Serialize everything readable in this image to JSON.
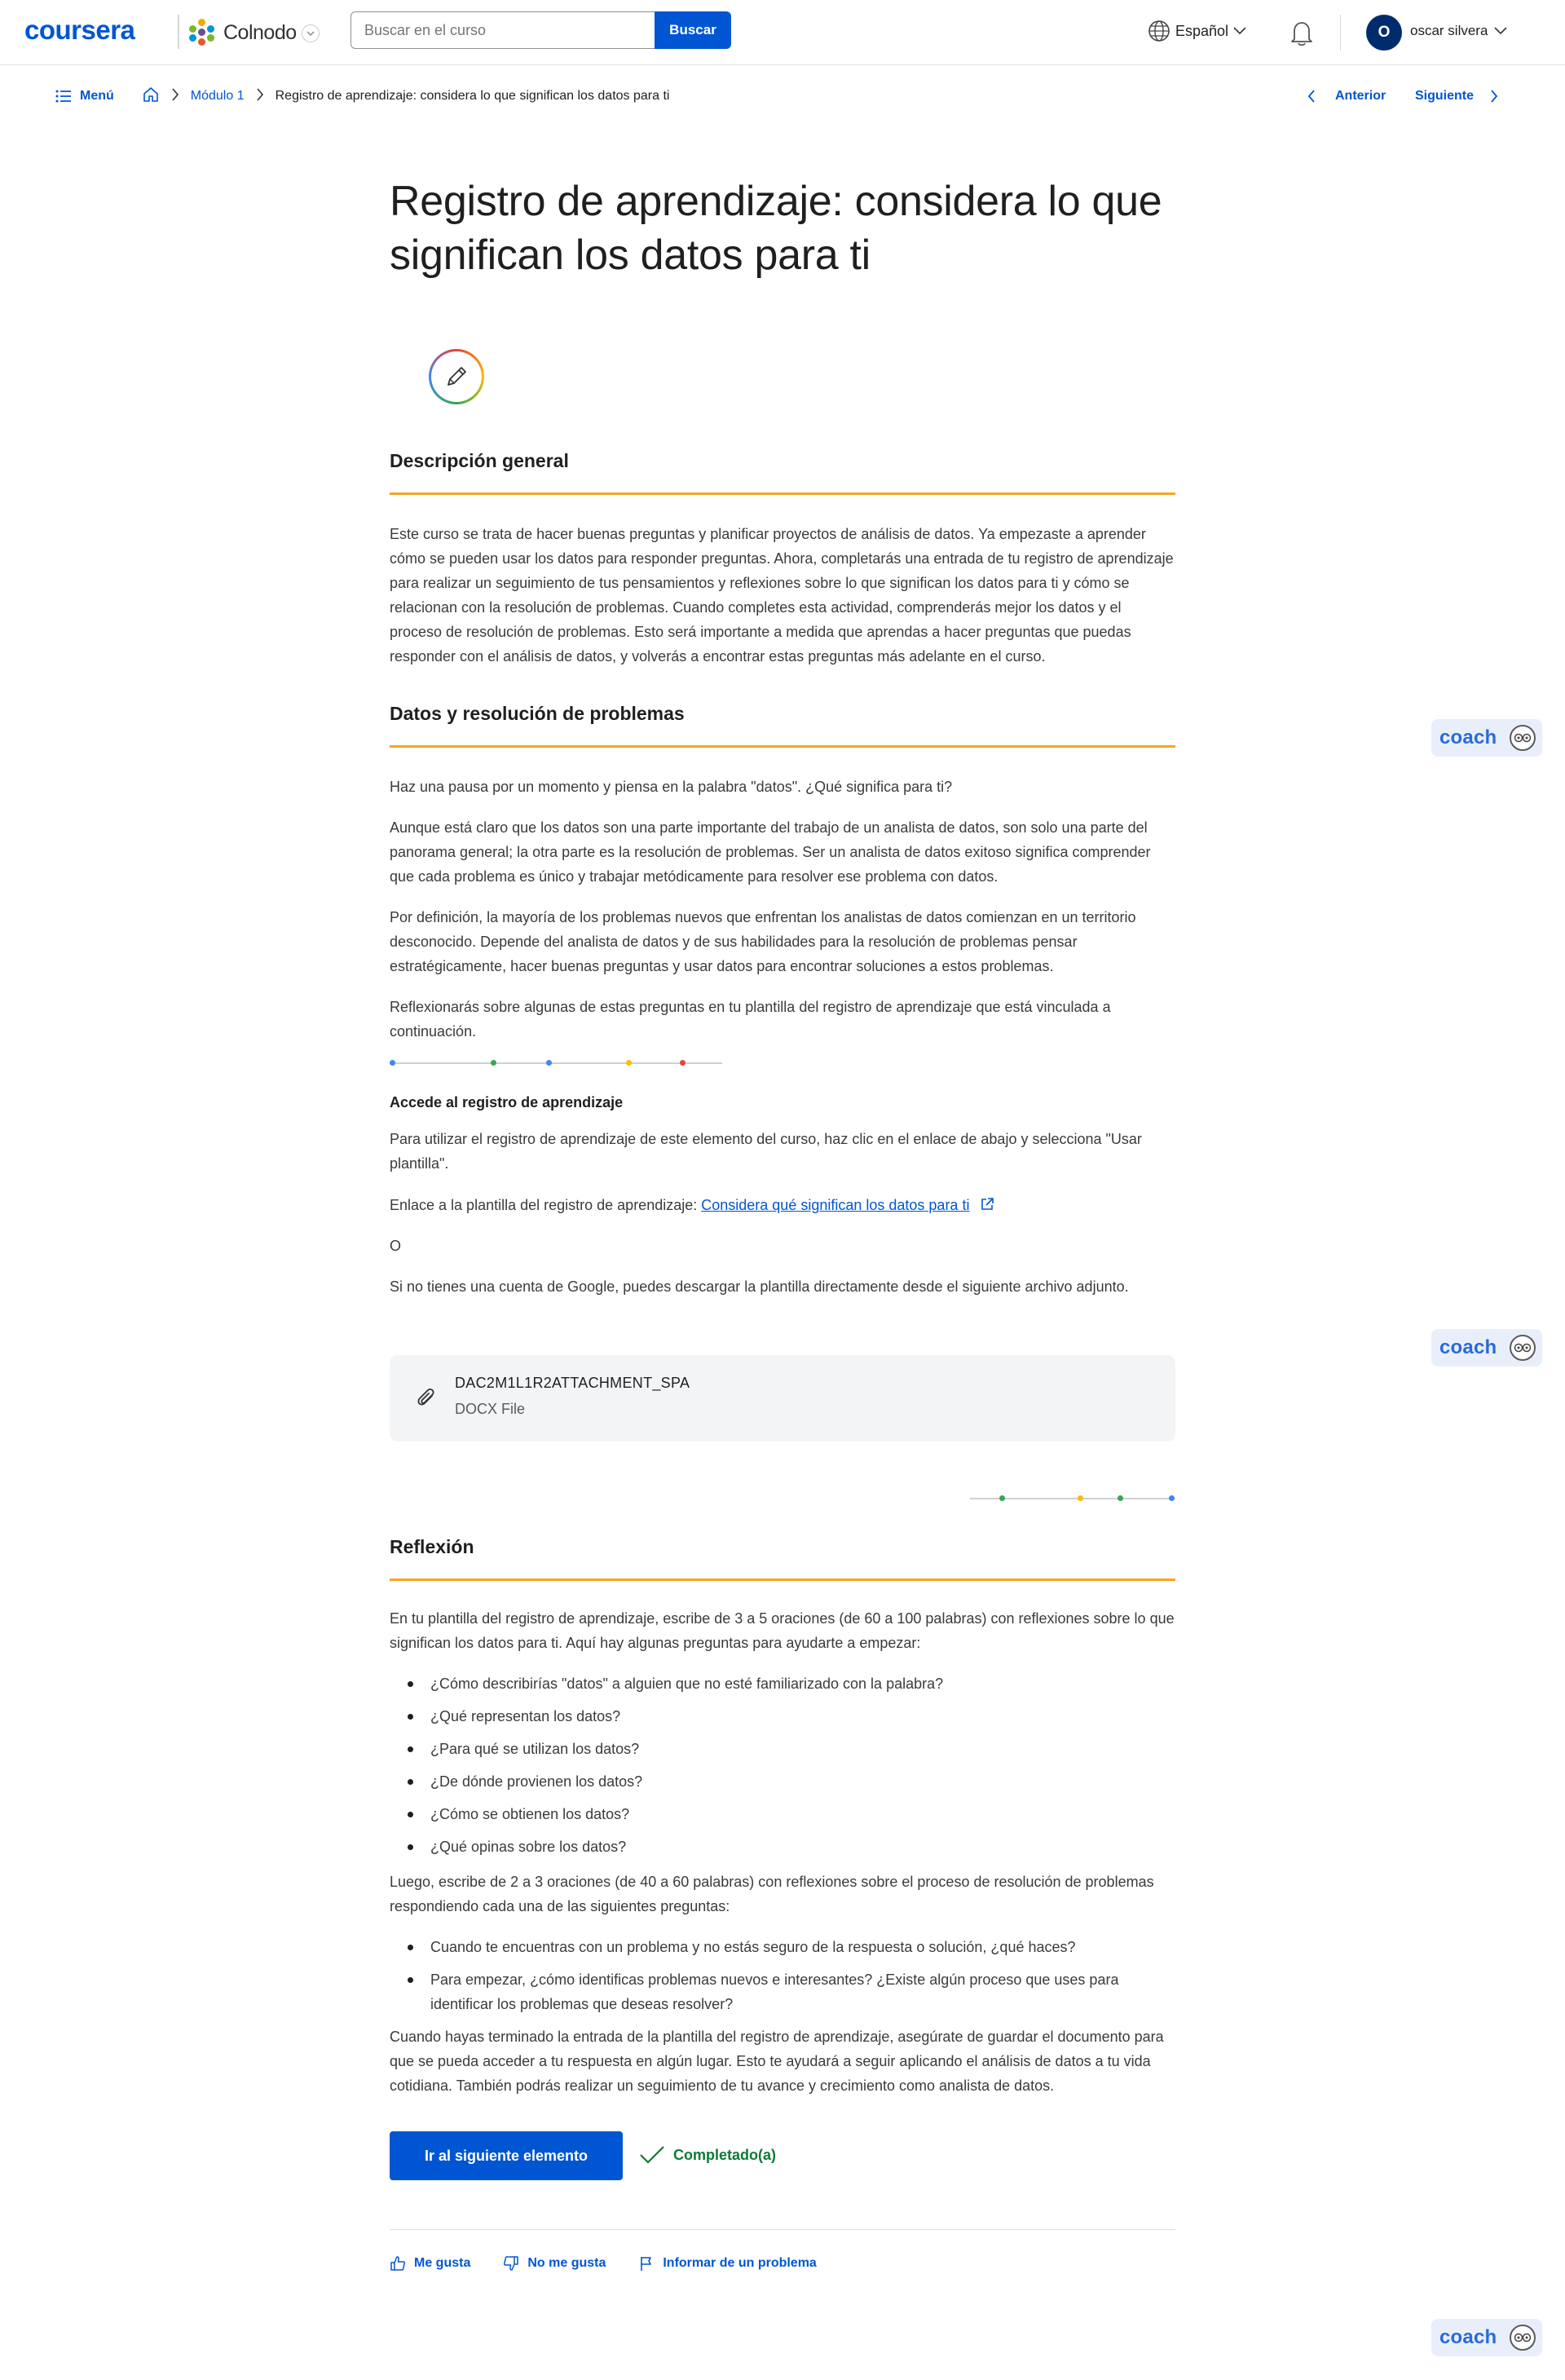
{
  "header": {
    "logo": "coursera",
    "partner": "Colnodo",
    "search_placeholder": "Buscar en el curso",
    "search_button": "Buscar",
    "language": "Español",
    "avatar_initial": "O",
    "username": "oscar silvera"
  },
  "breadcrumb": {
    "menu": "Menú",
    "module": "Módulo 1",
    "current": "Registro de aprendizaje: considera lo que significan los datos para ti",
    "prev": "Anterior",
    "next": "Siguiente"
  },
  "page": {
    "title": "Registro de aprendizaje: considera lo que significan los datos para ti",
    "s1_heading": "Descripción general",
    "s1_p1": "Este curso se trata de hacer buenas preguntas y planificar proyectos de análisis de datos. Ya empezaste a aprender cómo se pueden usar los datos para responder preguntas. Ahora, completarás una entrada de tu registro de aprendizaje para realizar un seguimiento de tus pensamientos y reflexiones sobre lo que significan los datos para ti y cómo se relacionan con la resolución de problemas. Cuando completes esta actividad, comprenderás mejor los datos y el proceso de resolución de problemas. Esto será importante a medida que aprendas a hacer preguntas que puedas responder con el análisis de datos, y volverás a encontrar estas preguntas más adelante en el curso.",
    "s2_heading": "Datos y resolución de problemas",
    "s2_p1": "Haz una pausa por un momento y piensa en la palabra \"datos\". ¿Qué significa para ti?",
    "s2_p2": "Aunque está claro que los datos son una parte importante del trabajo de un analista de datos, son solo una parte del panorama general; la otra parte es la resolución de problemas. Ser un analista de datos exitoso significa comprender que cada problema es único y trabajar metódicamente para resolver ese problema con datos.",
    "s2_p3": "Por definición, la mayoría de los problemas nuevos que enfrentan los analistas de datos comienzan en un territorio desconocido. Depende del analista de datos y de sus habilidades para la resolución de problemas pensar estratégicamente, hacer buenas preguntas y usar datos para encontrar soluciones a estos problemas.",
    "s2_p4": "Reflexionarás sobre algunas de estas preguntas en tu plantilla del registro de aprendizaje que está vinculada a continuación.",
    "access_heading": "Accede al registro de aprendizaje",
    "access_p1": "Para utilizar el registro de aprendizaje de este elemento del curso, haz clic en el enlace de abajo y selecciona \"Usar plantilla\".",
    "link_prefix": "Enlace a la plantilla del registro de aprendizaje: ",
    "link_text": "Considera qué significan los datos para ti",
    "or_text": "O",
    "download_p": "Si no tienes una cuenta de Google, puedes descargar la plantilla directamente desde el siguiente archivo adjunto.",
    "s3_heading": "Reflexión",
    "s3_p1": "En tu plantilla del registro de aprendizaje, escribe de 3 a 5 oraciones (de 60 a 100 palabras) con reflexiones sobre lo que significan los datos para ti. Aquí hay algunas preguntas para ayudarte a empezar:",
    "s3_list1": [
      "¿Cómo describirías \"datos\" a alguien que no esté familiarizado con la palabra?",
      "¿Qué representan los datos?",
      "¿Para qué se utilizan los datos?",
      "¿De dónde provienen los datos?",
      "¿Cómo se obtienen los datos?",
      "¿Qué opinas sobre los datos?"
    ],
    "s3_p2": "Luego, escribe de 2 a 3 oraciones (de 40 a 60 palabras) con reflexiones sobre el proceso de resolución de problemas respondiendo cada una de las siguientes preguntas:",
    "s3_list2": [
      "Cuando te encuentras con un problema y no estás seguro de la respuesta o solución, ¿qué haces?",
      "Para empezar, ¿cómo identificas problemas nuevos e interesantes? ¿Existe algún proceso que uses para identificar los problemas que deseas resolver?"
    ],
    "s3_p3": "Cuando hayas terminado la entrada de la plantilla del registro de aprendizaje, asegúrate de guardar el documento para que se pueda acceder a tu respuesta en algún lugar. Esto te ayudará a seguir aplicando el análisis de datos a tu vida cotidiana. También podrás realizar un seguimiento de tu avance y crecimiento como analista de datos."
  },
  "attachment": {
    "name": "DAC2M1L1R2ATTACHMENT_SPA",
    "type": "DOCX File"
  },
  "actions": {
    "next_item": "Ir al siguiente elemento",
    "completed": "Completado(a)",
    "like": "Me gusta",
    "dislike": "No me gusta",
    "report": "Informar de un problema"
  },
  "coach": {
    "label": "coach"
  },
  "colors": {
    "brand": "#0056d2",
    "section_rule": "#f5a623",
    "completed": "#0f7a37",
    "coach_bg": "#e8effb"
  }
}
